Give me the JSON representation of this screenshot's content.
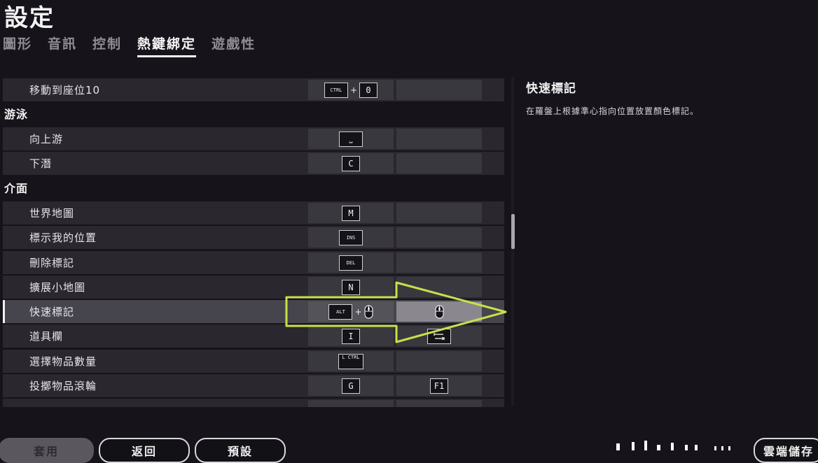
{
  "header": {
    "title": "設定"
  },
  "tabs": [
    {
      "label": "圖形",
      "active": false
    },
    {
      "label": "音訊",
      "active": false
    },
    {
      "label": "控制",
      "active": false
    },
    {
      "label": "熱鍵綁定",
      "active": true
    },
    {
      "label": "遊戲性",
      "active": false
    }
  ],
  "list": {
    "row_move10": {
      "label": "移動到座位10",
      "primary": [
        "CTRL",
        "0"
      ]
    },
    "cat_swim": "游泳",
    "row_swim_up": {
      "label": "向上游",
      "primary": [
        "⎵"
      ]
    },
    "row_dive": {
      "label": "下潛",
      "primary": [
        "C"
      ]
    },
    "cat_interface": "介面",
    "row_world_map": {
      "label": "世界地圖",
      "primary": [
        "M"
      ]
    },
    "row_mark_pos": {
      "label": "標示我的位置",
      "primary": [
        "INS"
      ]
    },
    "row_del_mark": {
      "label": "刪除標記",
      "primary": [
        "DEL"
      ]
    },
    "row_minimap": {
      "label": "擴展小地圖",
      "primary": [
        "N"
      ]
    },
    "row_quick_mark": {
      "label": "快速標記",
      "primary": [
        "ALT",
        "mouse-middle"
      ],
      "secondary": [
        "mouse-middle"
      ],
      "selected": true
    },
    "row_toolbar": {
      "label": "道具欄",
      "primary": [
        "I"
      ],
      "secondary": [
        "tab-key"
      ]
    },
    "row_item_qty": {
      "label": "選擇物品數量",
      "primary": [
        "L CTRL"
      ]
    },
    "row_throw_item": {
      "label": "投擲物品滾輪",
      "primary": [
        "G"
      ],
      "secondary": [
        "F1"
      ]
    }
  },
  "info": {
    "title": "快速標記",
    "description": "在羅盤上根據準心指向位置放置顏色標記。"
  },
  "buttons": {
    "apply": "套用",
    "back": "返回",
    "default": "預設",
    "cloud": "雲端儲存"
  },
  "colors": {
    "background": "#16141a",
    "row": "#2a282e",
    "selected_row": "#46444c",
    "highlight_arrow": "#c8e04a"
  }
}
